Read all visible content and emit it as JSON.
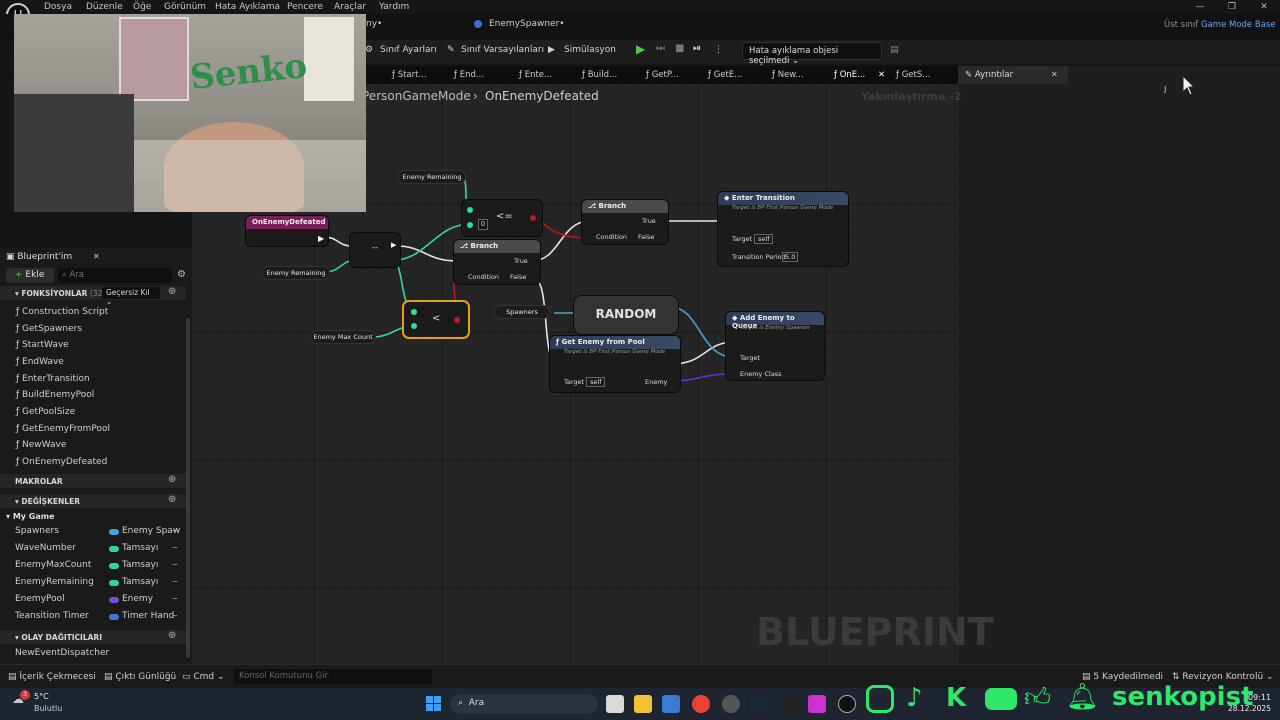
{
  "menubar": {
    "items": [
      "Dosya",
      "Düzenle",
      "Öğe",
      "Görünüm",
      "Hata Ayıklama",
      "Pencere",
      "Araçlar",
      "Yardım"
    ],
    "parent_class_label": "Üst sınıf",
    "parent_class_value": "Game Mode Base"
  },
  "doc_tabs": {
    "partial": "ny•",
    "enemy_spawner": "EnemySpawner•"
  },
  "toolbar": {
    "class_settings": "Sınıf Ayarları",
    "class_defaults": "Sınıf Varsayılanları",
    "simulation": "Simülasyon",
    "debug_dropdown": "Hata ayıklama objesi seçilmedi"
  },
  "graph_tabs": [
    "Start...",
    "End...",
    "Ente...",
    "Build...",
    "GetP...",
    "GetE...",
    "New...",
    "OnE...",
    "GetS..."
  ],
  "details_tab": "Ayrıntılar",
  "breadcrumb": {
    "parent": "PersonGameMode",
    "current": "OnEnemyDefeated",
    "zoom": "Yakınlaştırma -2"
  },
  "watermark": "BLUEPRINT",
  "left_panel": {
    "title": "Blueprint'im",
    "add_label": "Ekle",
    "search_placeholder": "Ara",
    "functions_header": "FONKSİYONLAR",
    "functions_count": "(32 GEÇE",
    "override_label": "Geçersiz Kıl",
    "functions": [
      "Construction Script",
      "GetSpawners",
      "StartWave",
      "EndWave",
      "EnterTransition",
      "BuildEnemyPool",
      "GetPoolSize",
      "GetEnemyFromPool",
      "NewWave",
      "OnEnemyDefeated"
    ],
    "macros_header": "MAKROLAR",
    "variables_header": "DEĞİŞKENLER",
    "category": "My Game",
    "variables": [
      {
        "name": "Spawners",
        "type": "Enemy Spaw",
        "color": "#3fa7d6"
      },
      {
        "name": "WaveNumber",
        "type": "Tamsayı",
        "color": "#2fd5a8"
      },
      {
        "name": "EnemyMaxCount",
        "type": "Tamsayı",
        "color": "#2fd5a8"
      },
      {
        "name": "EnemyRemaining",
        "type": "Tamsayı",
        "color": "#2fd5a8"
      },
      {
        "name": "EnemyPool",
        "type": "Enemy",
        "color": "#7b4fd6"
      },
      {
        "name": "Teansition Timer",
        "type": "Timer Hand",
        "color": "#3b7bd6"
      }
    ],
    "dispatchers_header": "OLAY DAĞITICILARI",
    "dispatcher": "NewEventDispatcher"
  },
  "nodes": {
    "event": "OnEnemyDefeated",
    "enemy_remaining_1": "Enemy Remaining",
    "enemy_remaining_2": "Enemy Remaining",
    "enemy_max_count": "Enemy Max Count",
    "minus": "--",
    "lte": "<=",
    "lte_value": "0",
    "lt": "<",
    "branch1_title": "Branch",
    "branch1_true": "True",
    "branch1_false": "False",
    "branch1_cond": "Condition",
    "branch2_title": "Branch",
    "branch2_true": "True",
    "branch2_false": "False",
    "branch2_cond": "Condition",
    "enter_title": "Enter Transition",
    "enter_sub": "Target is BP First Person Game Mode",
    "enter_target": "Target",
    "enter_self": "self",
    "enter_period": "Transition Period",
    "enter_period_val": "5.0",
    "spawners": "Spawners",
    "random": "RANDOM",
    "pool_title": "Get Enemy from Pool",
    "pool_sub": "Target is BP First Person Game Mode",
    "pool_target": "Target",
    "pool_self": "self",
    "pool_enemy": "Enemy",
    "queue_title": "Add Enemy to Queue",
    "queue_sub": "Target is Enemy Spawner",
    "queue_target": "Target",
    "queue_class": "Enemy Class"
  },
  "bottombar": {
    "content_drawer": "İçerik Çekmecesi",
    "output_log": "Çıktı Günlüğü",
    "cmd": "Cmd",
    "console_placeholder": "Konsol Komutunu Gir",
    "saved": "5 Kaydedilmedi",
    "revision": "Revizyon Kontrolü"
  },
  "taskbar": {
    "weather_temp": "5°C",
    "weather_desc": "Bulutlu",
    "weather_badge": "3",
    "search": "Ara",
    "time": "09:11",
    "date": "28.12.2025",
    "channel": "senkopist"
  },
  "webcam": {
    "painting_text": "Senko"
  }
}
